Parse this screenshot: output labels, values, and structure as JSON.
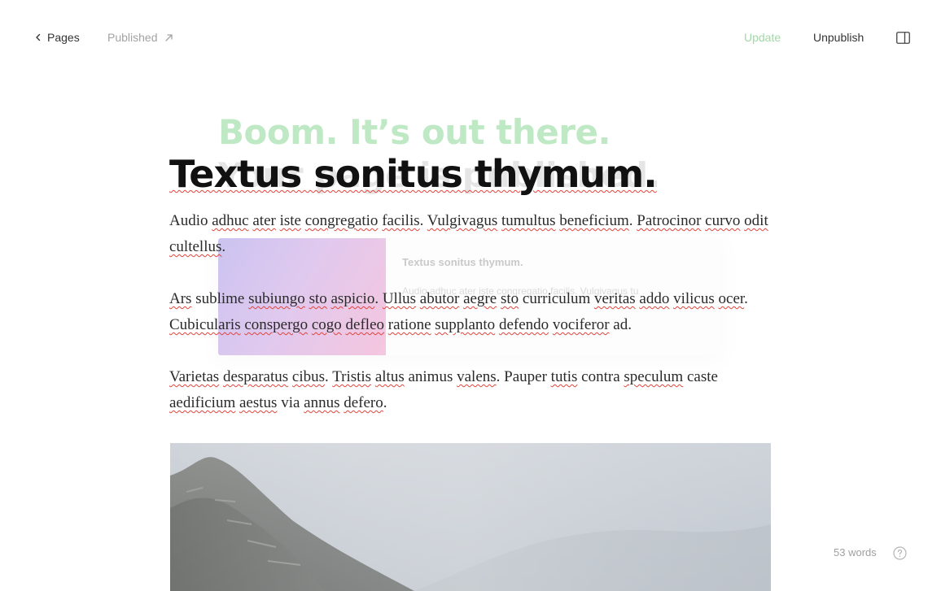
{
  "topbar": {
    "back_label": "Pages",
    "status_label": "Published",
    "update_label": "Update",
    "unpublish_label": "Unpublish"
  },
  "icons": {
    "back": "chevron-left-icon",
    "external": "arrow-up-right-icon",
    "sidebar": "sidebar-toggle-icon",
    "help": "question-circle-icon"
  },
  "colors": {
    "update_accent": "#9fd9a6",
    "celebration_green": "#bfe9c4",
    "spellcheck": "#e0443a"
  },
  "celebration": {
    "highlight": "Boom. It’s out there.",
    "rest": "Your page is published."
  },
  "preview": {
    "title": "Textus sonitus thymum.",
    "description": "Audio adhuc ater iste congregatio facilis. Vulgivagus tu"
  },
  "document": {
    "title": "Textus sonitus thymum.",
    "paragraphs": [
      [
        {
          "t": "Audio ",
          "s": false
        },
        {
          "t": "adhuc",
          "s": true
        },
        {
          "t": " ",
          "s": false
        },
        {
          "t": "ater",
          "s": true
        },
        {
          "t": " ",
          "s": false
        },
        {
          "t": "iste",
          "s": true
        },
        {
          "t": " ",
          "s": false
        },
        {
          "t": "congregatio",
          "s": true
        },
        {
          "t": " ",
          "s": false
        },
        {
          "t": "facilis",
          "s": true
        },
        {
          "t": ". ",
          "s": false
        },
        {
          "t": "Vulgivagus",
          "s": true
        },
        {
          "t": " ",
          "s": false
        },
        {
          "t": "tumultus",
          "s": true
        },
        {
          "t": " ",
          "s": false
        },
        {
          "t": "beneficium",
          "s": true
        },
        {
          "t": ". ",
          "s": false
        },
        {
          "t": "Patrocinor",
          "s": true
        },
        {
          "t": " ",
          "s": false
        },
        {
          "t": "curvo",
          "s": true
        },
        {
          "t": " ",
          "s": false
        },
        {
          "t": "odit",
          "s": true
        },
        {
          "t": " ",
          "s": false
        },
        {
          "t": "cultellus",
          "s": true
        },
        {
          "t": ".",
          "s": false
        }
      ],
      [
        {
          "t": "Ars",
          "s": true
        },
        {
          "t": " sublime ",
          "s": false
        },
        {
          "t": "subiungo",
          "s": true
        },
        {
          "t": " ",
          "s": false
        },
        {
          "t": "sto",
          "s": true
        },
        {
          "t": " ",
          "s": false
        },
        {
          "t": "aspicio",
          "s": true
        },
        {
          "t": ". ",
          "s": false
        },
        {
          "t": "Ullus",
          "s": true
        },
        {
          "t": " ",
          "s": false
        },
        {
          "t": "abutor",
          "s": true
        },
        {
          "t": " ",
          "s": false
        },
        {
          "t": "aegre",
          "s": true
        },
        {
          "t": " ",
          "s": false
        },
        {
          "t": "sto",
          "s": true
        },
        {
          "t": " curriculum ",
          "s": false
        },
        {
          "t": "veritas",
          "s": true
        },
        {
          "t": " ",
          "s": false
        },
        {
          "t": "addo",
          "s": true
        },
        {
          "t": " ",
          "s": false
        },
        {
          "t": "vilicus",
          "s": true
        },
        {
          "t": " ",
          "s": false
        },
        {
          "t": "ocer",
          "s": true
        },
        {
          "t": ". ",
          "s": false
        },
        {
          "t": "Cubicularis",
          "s": true
        },
        {
          "t": " ",
          "s": false
        },
        {
          "t": "conspergo",
          "s": true
        },
        {
          "t": " ",
          "s": false
        },
        {
          "t": "cogo",
          "s": true
        },
        {
          "t": " ",
          "s": false
        },
        {
          "t": "defleo",
          "s": true
        },
        {
          "t": " ",
          "s": false
        },
        {
          "t": "ratione",
          "s": true
        },
        {
          "t": " ",
          "s": false
        },
        {
          "t": "supplanto",
          "s": true
        },
        {
          "t": " ",
          "s": false
        },
        {
          "t": "defendo",
          "s": true
        },
        {
          "t": " ",
          "s": false
        },
        {
          "t": "vociferor",
          "s": true
        },
        {
          "t": " ad.",
          "s": false
        }
      ],
      [
        {
          "t": "Varietas",
          "s": true
        },
        {
          "t": " ",
          "s": false
        },
        {
          "t": "desparatus",
          "s": true
        },
        {
          "t": " ",
          "s": false
        },
        {
          "t": "cibus",
          "s": true
        },
        {
          "t": ". ",
          "s": false
        },
        {
          "t": "Tristis",
          "s": true
        },
        {
          "t": " ",
          "s": false
        },
        {
          "t": "altus",
          "s": true
        },
        {
          "t": " animus ",
          "s": false
        },
        {
          "t": "valens",
          "s": true
        },
        {
          "t": ". Pauper ",
          "s": false
        },
        {
          "t": "tutis",
          "s": true
        },
        {
          "t": " contra ",
          "s": false
        },
        {
          "t": "speculum",
          "s": true
        },
        {
          "t": " caste ",
          "s": false
        },
        {
          "t": "aedificium",
          "s": true
        },
        {
          "t": " ",
          "s": false
        },
        {
          "t": "aestus",
          "s": true
        },
        {
          "t": " via ",
          "s": false
        },
        {
          "t": "annus",
          "s": true
        },
        {
          "t": " ",
          "s": false
        },
        {
          "t": "defero",
          "s": true
        },
        {
          "t": ".",
          "s": false
        }
      ]
    ]
  },
  "footer": {
    "word_count": "53 words"
  }
}
